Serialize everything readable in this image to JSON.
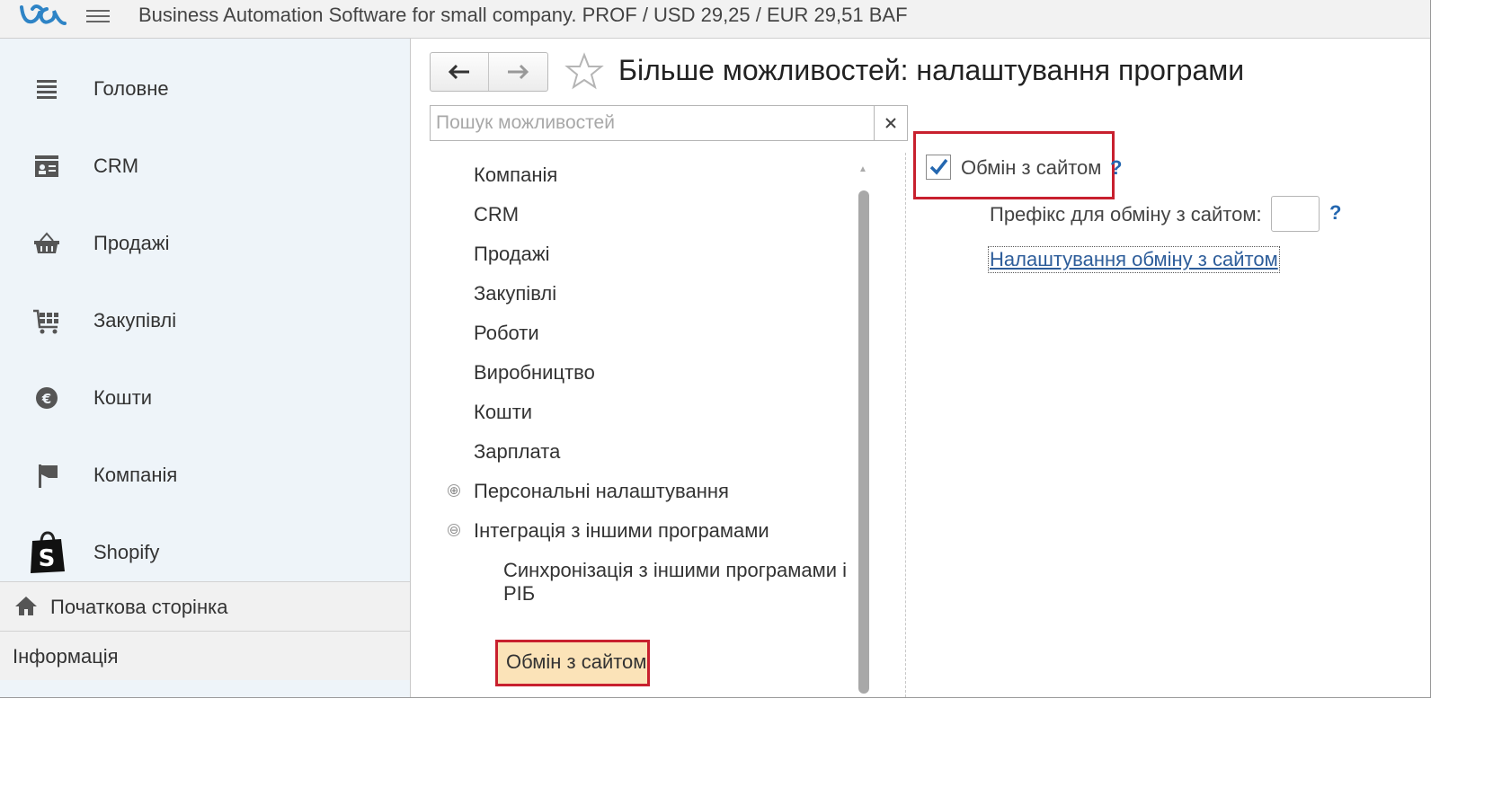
{
  "app": {
    "title": "Business Automation Software for small company. PROF / USD 29,25 / EUR 29,51 BAF",
    "accent_color": "#2e84c6",
    "highlight_color": "#c8202e",
    "selected_bg": "#fbe3b8"
  },
  "sidebar": {
    "items": [
      {
        "label": "Головне",
        "icon": "list-lines-icon"
      },
      {
        "label": "CRM",
        "icon": "contact-card-icon"
      },
      {
        "label": "Продажі",
        "icon": "shopping-basket-icon"
      },
      {
        "label": "Закупівлі",
        "icon": "cart-grid-icon"
      },
      {
        "label": "Кошти",
        "icon": "money-coin-icon"
      },
      {
        "label": "Компанія",
        "icon": "flag-icon"
      },
      {
        "label": "Shopify",
        "icon": "shopify-bag-icon"
      }
    ],
    "home_label": "Початкова сторінка",
    "info_label": "Інформація"
  },
  "main": {
    "page_title": "Більше можливостей: налаштування програми",
    "search": {
      "placeholder": "Пошук можливостей",
      "value": ""
    },
    "tree": [
      {
        "label": "Компанія"
      },
      {
        "label": "CRM"
      },
      {
        "label": "Продажі"
      },
      {
        "label": "Закупівлі"
      },
      {
        "label": "Роботи"
      },
      {
        "label": "Виробництво"
      },
      {
        "label": "Кошти"
      },
      {
        "label": "Зарплата"
      },
      {
        "label": "Персональні налаштування",
        "toggle": "⊕"
      },
      {
        "label": "Інтеграція з іншими програмами",
        "toggle": "⊖"
      },
      {
        "label_line1": "Синхронізація з іншими програмами і",
        "label_line2": "РІБ"
      },
      {
        "label": "Обмін з сайтом",
        "selected": true
      }
    ]
  },
  "settings": {
    "exchange_checkbox_label": "Обмін з сайтом",
    "exchange_checked": true,
    "help_mark": "?",
    "prefix_label": "Префікс для обміну з сайтом:",
    "prefix_value": "",
    "link_label": "Налаштування обміну з сайтом"
  }
}
